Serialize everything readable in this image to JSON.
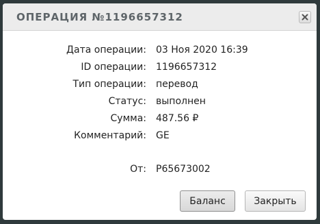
{
  "dialog": {
    "title": "ОПЕРАЦИЯ №1196657312",
    "close_icon": "close-icon"
  },
  "details": [
    {
      "label": "Дата операции:",
      "value": "03 Ноя 2020 16:39"
    },
    {
      "label": "ID операции:",
      "value": "1196657312"
    },
    {
      "label": "Тип операции:",
      "value": "перевод"
    },
    {
      "label": "Статус:",
      "value": "выполнен"
    },
    {
      "label": "Сумма:",
      "value": "487.56 ₽"
    },
    {
      "label": "Комментарий:",
      "value": "GE"
    }
  ],
  "from": {
    "label": "От:",
    "value": "P65673002"
  },
  "buttons": {
    "balance": "Баланс",
    "close": "Закрыть"
  },
  "colors": {
    "backdrop": "#2f3a3c",
    "titlebar": "#ececec",
    "title_text": "#5e6569"
  }
}
